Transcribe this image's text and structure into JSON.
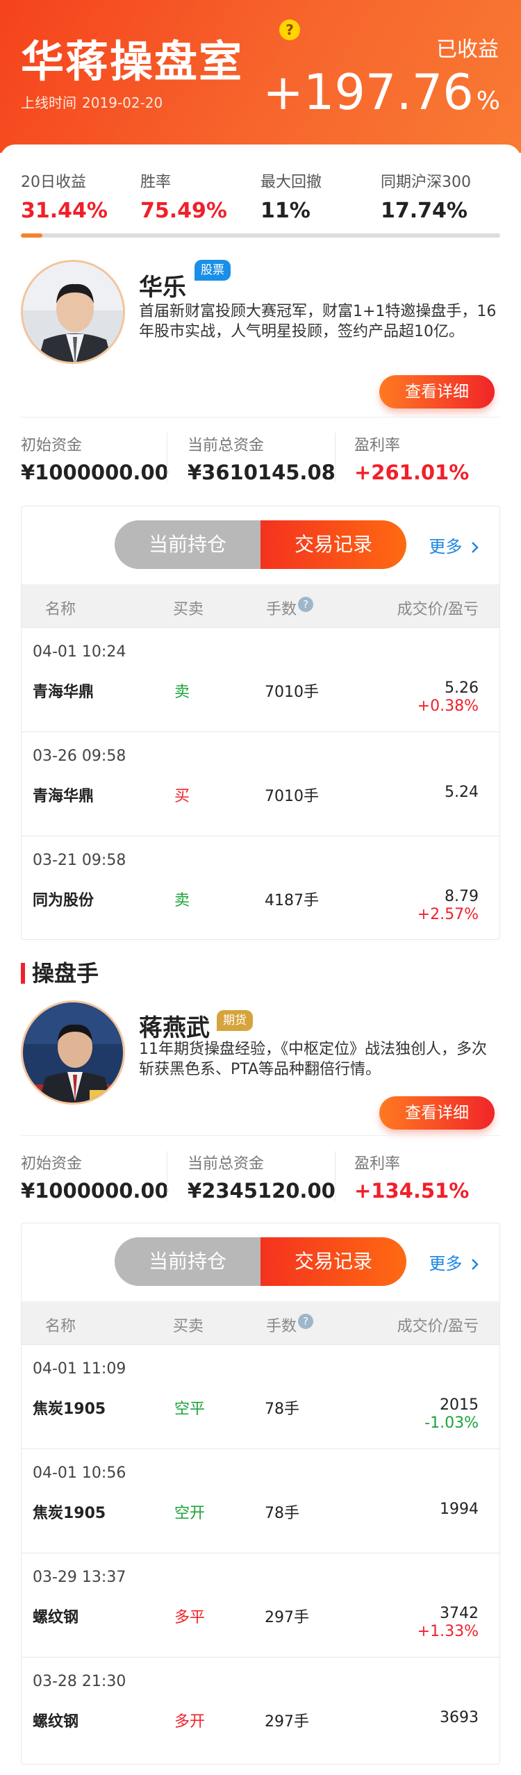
{
  "header": {
    "brand": "华蒋操盘室",
    "help_icon": "?",
    "online_label": "上线时间",
    "online_date": "2019-02-20",
    "earned_label": "已收益",
    "earned_value": "+197.76",
    "earned_unit": "%",
    "header_gradient": "#f5421c"
  },
  "stats": [
    {
      "label": "20日收益",
      "value": "31.44%",
      "red": true
    },
    {
      "label": "胜率",
      "value": "75.49%",
      "red": true
    },
    {
      "label": "最大回撤",
      "value": "11%",
      "red": false
    },
    {
      "label": "同期沪深300",
      "value": "17.74%",
      "red": false
    }
  ],
  "progress_fraction": 0.045,
  "section_title": "操盘手",
  "traders": [
    {
      "name": "华乐",
      "tag": "股票",
      "tag_color": "#1a8fe8",
      "desc": "首届新财富投顾大赛冠军，财富1+1特邀操盘手，16年股市实战，人气明星投顾，签约产品超10亿。",
      "detail_button": "查看详细",
      "funds": [
        {
          "label": "初始资金",
          "value": "¥1000000.00"
        },
        {
          "label": "当前总资金",
          "value": "¥3610145.08"
        },
        {
          "label": "盈利率",
          "value": "+261.01%"
        }
      ],
      "tabs": {
        "holdings": "当前持仓",
        "trades": "交易记录",
        "more": "更多"
      },
      "columns": {
        "name": "名称",
        "side": "买卖",
        "qty": "手数",
        "price": "成交价/盈亏"
      },
      "trades": [
        {
          "date": "04-01 10:24",
          "stock": "青海华鼎",
          "side": "卖",
          "side_type": "sell",
          "qty": "7010手",
          "price": "5.26",
          "pl": "+0.38%",
          "pl_type": "up"
        },
        {
          "date": "03-26 09:58",
          "stock": "青海华鼎",
          "side": "买",
          "side_type": "buy",
          "qty": "7010手",
          "price": "5.24",
          "pl": "",
          "pl_type": ""
        },
        {
          "date": "03-21 09:58",
          "stock": "同为股份",
          "side": "卖",
          "side_type": "sell",
          "qty": "4187手",
          "price": "8.79",
          "pl": "+2.57%",
          "pl_type": "up"
        }
      ]
    },
    {
      "name": "蒋燕武",
      "tag": "期货",
      "tag_color": "#d6a43c",
      "desc": "11年期货操盘经验，《中枢定位》战法独创人，多次斩获黑色系、PTA等品种翻倍行情。",
      "detail_button": "查看详细",
      "funds": [
        {
          "label": "初始资金",
          "value": "¥1000000.00"
        },
        {
          "label": "当前总资金",
          "value": "¥2345120.00"
        },
        {
          "label": "盈利率",
          "value": "+134.51%"
        }
      ],
      "tabs": {
        "holdings": "当前持仓",
        "trades": "交易记录",
        "more": "更多"
      },
      "columns": {
        "name": "名称",
        "side": "买卖",
        "qty": "手数",
        "price": "成交价/盈亏"
      },
      "trades": [
        {
          "date": "04-01 11:09",
          "stock": "焦炭1905",
          "side": "空平",
          "side_type": "sell",
          "qty": "78手",
          "price": "2015",
          "pl": "-1.03%",
          "pl_type": "down"
        },
        {
          "date": "04-01 10:56",
          "stock": "焦炭1905",
          "side": "空开",
          "side_type": "sell",
          "qty": "78手",
          "price": "1994",
          "pl": "",
          "pl_type": ""
        },
        {
          "date": "03-29 13:37",
          "stock": "螺纹钢",
          "side": "多平",
          "side_type": "buy",
          "qty": "297手",
          "price": "3742",
          "pl": "+1.33%",
          "pl_type": "up"
        },
        {
          "date": "03-28 21:30",
          "stock": "螺纹钢",
          "side": "多开",
          "side_type": "buy",
          "qty": "297手",
          "price": "3693",
          "pl": "",
          "pl_type": ""
        }
      ]
    }
  ]
}
